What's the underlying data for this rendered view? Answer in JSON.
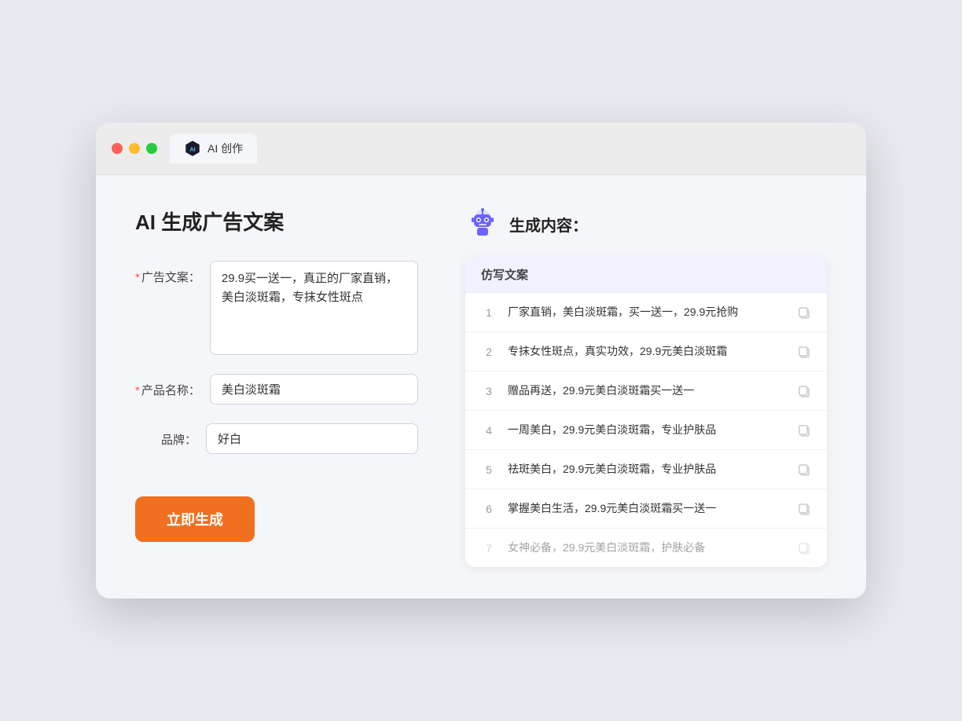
{
  "window": {
    "tab_label": "AI 创作"
  },
  "left_panel": {
    "title": "AI 生成广告文案",
    "fields": [
      {
        "label": "广告文案：",
        "required": true,
        "type": "textarea",
        "value": "29.9买一送一，真正的厂家直销，美白淡斑霜，专抹女性斑点",
        "name": "ad-copy-textarea"
      },
      {
        "label": "产品名称：",
        "required": true,
        "type": "input",
        "value": "美白淡斑霜",
        "name": "product-name-input"
      },
      {
        "label": "品牌：",
        "required": false,
        "type": "input",
        "value": "好白",
        "name": "brand-input"
      }
    ],
    "button_label": "立即生成"
  },
  "right_panel": {
    "title": "生成内容：",
    "table_header": "仿写文案",
    "results": [
      {
        "num": "1",
        "text": "厂家直销，美白淡斑霜，买一送一，29.9元抢购",
        "faded": false
      },
      {
        "num": "2",
        "text": "专抹女性斑点，真实功效，29.9元美白淡斑霜",
        "faded": false
      },
      {
        "num": "3",
        "text": "赠品再送，29.9元美白淡斑霜买一送一",
        "faded": false
      },
      {
        "num": "4",
        "text": "一周美白，29.9元美白淡斑霜，专业护肤品",
        "faded": false
      },
      {
        "num": "5",
        "text": "祛斑美白，29.9元美白淡斑霜，专业护肤品",
        "faded": false
      },
      {
        "num": "6",
        "text": "掌握美白生活，29.9元美白淡斑霜买一送一",
        "faded": false
      },
      {
        "num": "7",
        "text": "女神必备，29.9元美白淡斑霜，护肤必备",
        "faded": true
      }
    ]
  },
  "colors": {
    "accent": "#f07020",
    "required_star": "#ff4d4f",
    "result_header_bg": "#f0f3ff"
  }
}
